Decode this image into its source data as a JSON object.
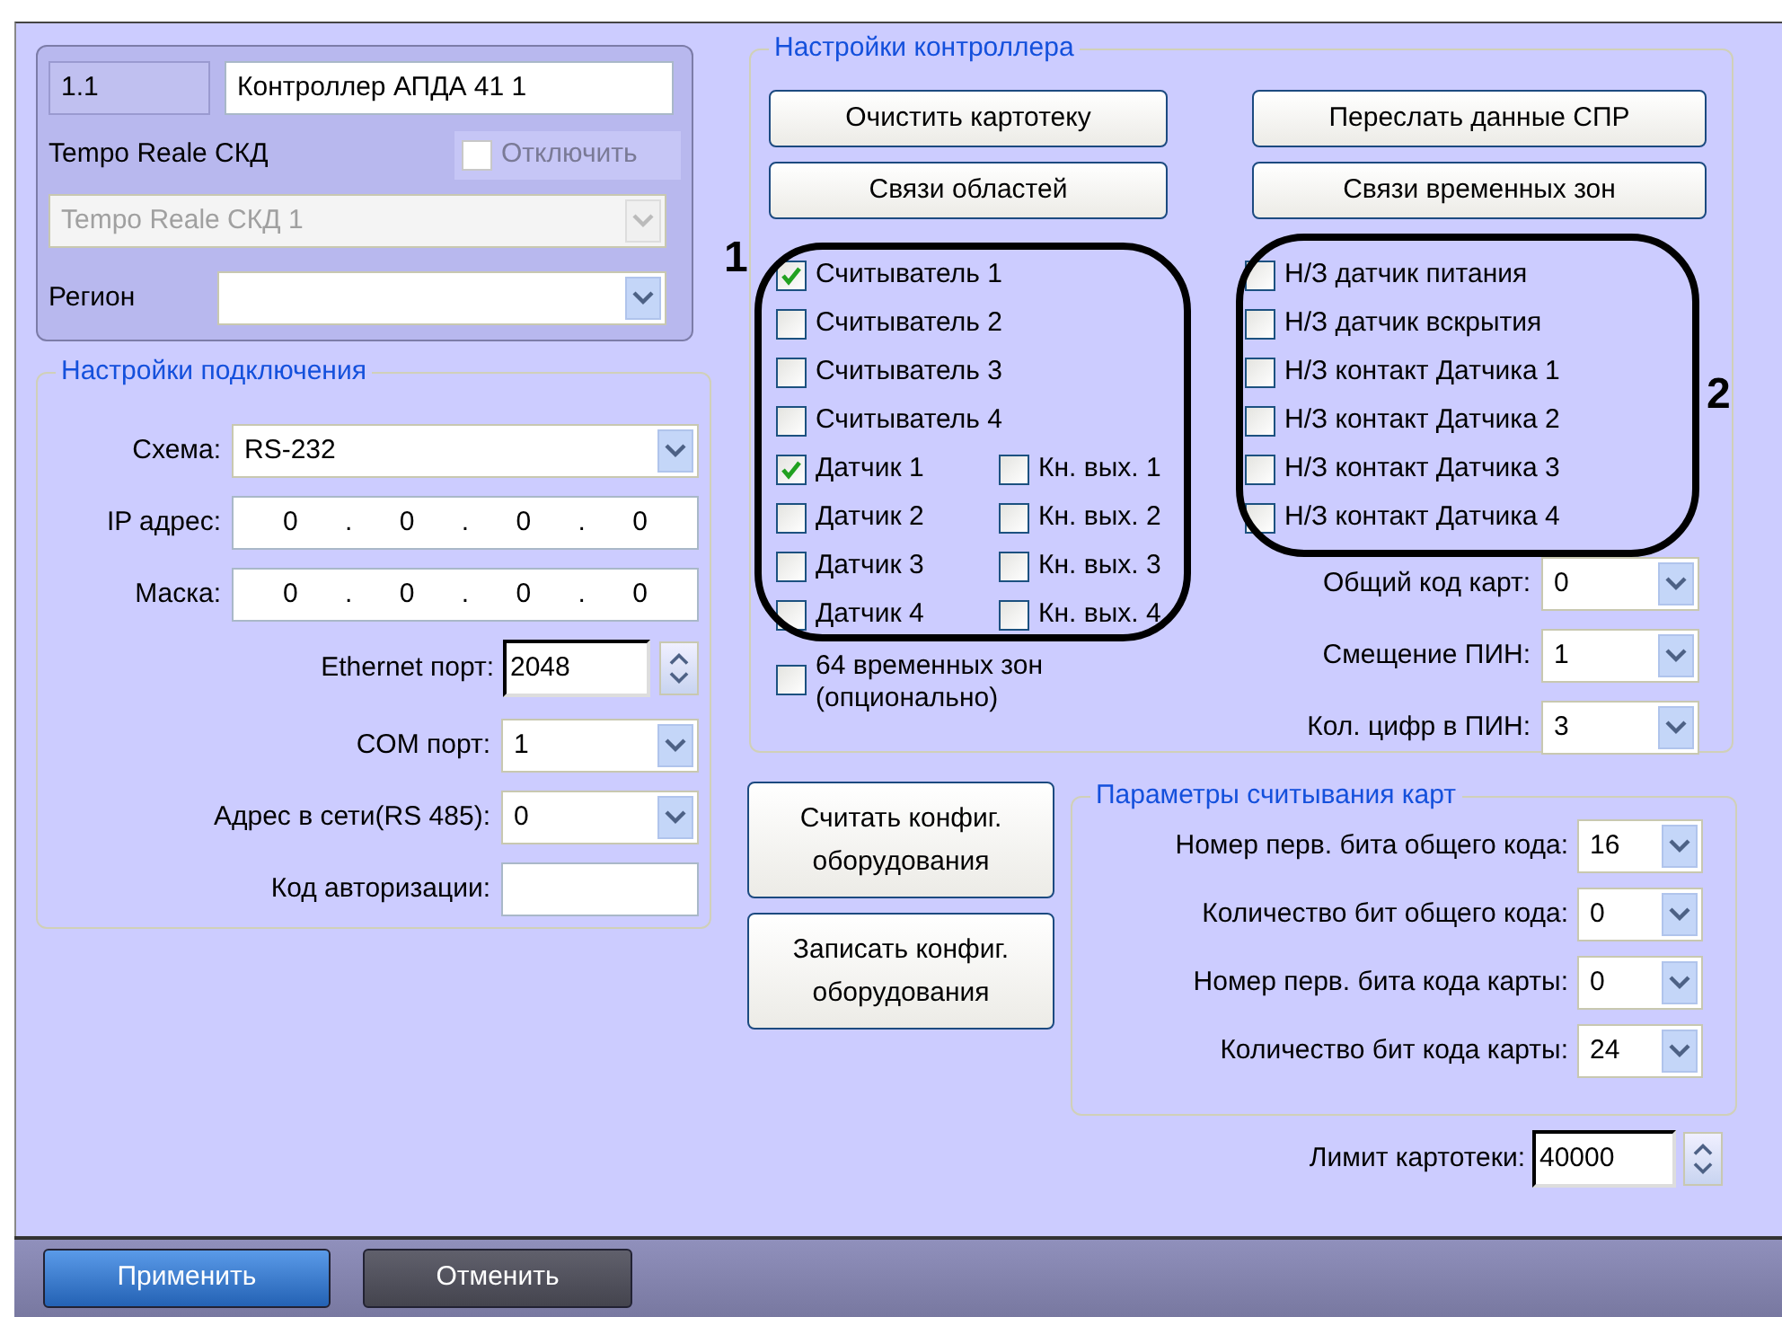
{
  "header": {
    "number": "1.1",
    "name": "Контроллер АПДА 41 1",
    "type_label": "Tempo Reale СКД",
    "disable": {
      "label": "Отключить",
      "checked": false,
      "disabled": true
    },
    "device_select": {
      "value": "Tempo Reale СКД 1",
      "disabled": true
    },
    "region": {
      "label": "Регион"
    }
  },
  "connection": {
    "title": "Настройки подключения",
    "fields": [
      {
        "kind": "select",
        "label": "Схема:",
        "value": "RS-232"
      },
      {
        "kind": "ip",
        "label": "IP адрес:",
        "value": "0 . 0 . 0 . 0"
      },
      {
        "kind": "ip",
        "label": "Маска:",
        "value": "0 . 0 . 0 . 0"
      },
      {
        "kind": "spin",
        "label": "Ethernet порт:",
        "value": "2048"
      },
      {
        "kind": "select",
        "label": "COM порт:",
        "value": "1"
      },
      {
        "kind": "select",
        "label": "Адрес в сети(RS 485):",
        "value": "0"
      },
      {
        "kind": "text",
        "label": "Код авторизации:"
      }
    ]
  },
  "controller": {
    "title": "Настройки контроллера",
    "buttons": [
      "Очистить картотеку",
      "Переслать данные СПР",
      "Связи областей",
      "Связи временных зон"
    ],
    "readers": [
      {
        "label": "Считыватель 1",
        "checked": true
      },
      {
        "label": "Считыватель 2",
        "checked": false
      },
      {
        "label": "Считыватель 3",
        "checked": false
      },
      {
        "label": "Считыватель 4",
        "checked": false
      }
    ],
    "sensors": [
      {
        "label": "Датчик 1",
        "checked": true
      },
      {
        "label": "Датчик 2",
        "checked": false
      },
      {
        "label": "Датчик 3",
        "checked": false
      },
      {
        "label": "Датчик 4",
        "checked": false
      }
    ],
    "exit_buttons": [
      {
        "label": "Кн. вых. 1",
        "checked": false
      },
      {
        "label": "Кн. вых. 2",
        "checked": false
      },
      {
        "label": "Кн. вых. 3",
        "checked": false
      },
      {
        "label": "Кн. вых. 4",
        "checked": false
      }
    ],
    "nc_contacts": [
      {
        "label": "Н/З датчик питания",
        "checked": false
      },
      {
        "label": "Н/З датчик вскрытия",
        "checked": false
      },
      {
        "label": "Н/З контакт Датчика 1",
        "checked": false
      },
      {
        "label": "Н/З контакт Датчика 2",
        "checked": false
      },
      {
        "label": "Н/З контакт Датчика 3",
        "checked": false
      },
      {
        "label": "Н/З контакт Датчика 4",
        "checked": false
      }
    ],
    "zones64": {
      "label": "64 временных зон (опционально)",
      "checked": false
    },
    "selects": [
      {
        "label": "Общий код карт:",
        "value": "0"
      },
      {
        "label": "Смещение ПИН:",
        "value": "1"
      },
      {
        "label": "Кол. цифр в ПИН:",
        "value": "3"
      }
    ]
  },
  "config_buttons": [
    "Считать конфиг. оборудования",
    "Записать конфиг. оборудования"
  ],
  "card_params": {
    "title": "Параметры считывания карт",
    "selects": [
      {
        "label": "Номер перв. бита общего кода:",
        "value": "16"
      },
      {
        "label": "Количество бит общего кода:",
        "value": "0"
      },
      {
        "label": "Номер перв. бита кода карты:",
        "value": "0"
      },
      {
        "label": "Количество бит кода карты:",
        "value": "24"
      }
    ]
  },
  "limit": {
    "label": "Лимит картотеки:",
    "value": "40000"
  },
  "annotations": [
    {
      "label": "1"
    },
    {
      "label": "2"
    }
  ],
  "footer": {
    "buttons": [
      {
        "label": "Применить",
        "kind": "primary"
      },
      {
        "label": "Отменить",
        "kind": "secondary"
      }
    ]
  }
}
